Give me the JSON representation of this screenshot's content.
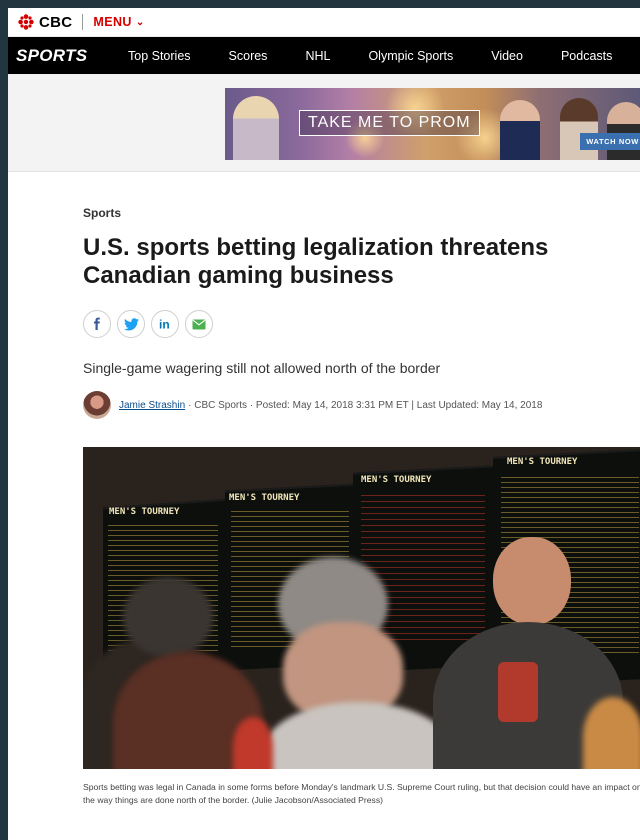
{
  "brand": {
    "name": "CBC",
    "menu_label": "MENU"
  },
  "sports_nav": {
    "section_label": "SPORTS",
    "items": [
      "Top Stories",
      "Scores",
      "NHL",
      "Olympic Sports",
      "Video",
      "Podcasts"
    ]
  },
  "ad": {
    "headline": "TAKE ME TO PROM",
    "cta": "WATCH NOW"
  },
  "article": {
    "kicker": "Sports",
    "headline": "U.S. sports betting legalization threatens Canadian gaming business",
    "deck": "Single-game wagering still not allowed north of the border",
    "author": "Jamie Strashin",
    "meta": "· CBC Sports · Posted: May 14, 2018 3:31 PM ET | Last Updated: May 14, 2018",
    "share": [
      "facebook-icon",
      "twitter-icon",
      "linkedin-icon",
      "email-icon"
    ],
    "photo": {
      "boards": [
        "MEN'S TOURNEY",
        "MEN'S TOURNEY",
        "MEN'S TOURNEY",
        "MEN'S TOURNEY"
      ]
    },
    "caption": "Sports betting was legal in Canada in some forms before Monday's landmark U.S. Supreme Court ruling, but that decision could have an impact on the way things are done north of the border. (Julie Jacobson/Associated Press)"
  },
  "colors": {
    "cbc_red": "#d40000",
    "nav_black": "#000000",
    "link_blue": "#0a4d8c",
    "frame": "#23363f"
  }
}
